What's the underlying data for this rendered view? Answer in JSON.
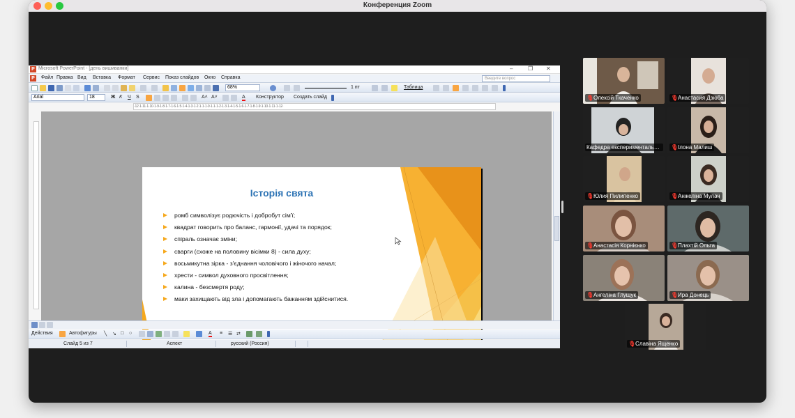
{
  "zoom": {
    "title": "Конференция Zoom"
  },
  "powerpoint": {
    "window_title": "Microsoft PowerPoint - [день вишиванки]",
    "menu": [
      "Файл",
      "Правка",
      "Вид",
      "Вставка",
      "Формат",
      "Сервис",
      "Показ слайдов",
      "Окно",
      "Справка"
    ],
    "ask_placeholder": "Введите вопрос",
    "zoom_level": "68%",
    "line_width": "1 пт",
    "table_label": "Таблица",
    "font_name": "Arial",
    "font_size": "18",
    "designer_label": "Конструктор",
    "new_slide_label": "Создать слайд",
    "draw_label": "Действия",
    "autoshapes_label": "Автофигуры",
    "ruler": "·12·1·11·1·10·1·9·1·8·1·7·1·6·1·5·1·4·1·3·1·2·1·1·1·0·1·1·1·2·1·3·1·4·1·5·1·6·1·7·1·8·1·9·1·10·1·11·1·12·",
    "status": {
      "slide": "Слайд 5 из 7",
      "design": "Аспект",
      "language": "русский (Россия)"
    }
  },
  "slide": {
    "title": "Історія свята",
    "bullets": [
      "ромб символізує родючість і добробут сім'ї;",
      "квадрат говорить про баланс, гармонії, удачі та порядок;",
      "спіраль означає зміни;",
      "сварги (схоже на половину вісімки 8) - сила духу;",
      "восьмикутна зірка - з'єднання чоловічого і жіночого начал;",
      "хрести - символ духовного просвітлення;",
      "калина - безсмертя роду;",
      "маки захищають від зла і допомагають бажанням здійснитися."
    ],
    "accent_color": "#f6a81c",
    "title_color": "#2e74b5"
  },
  "participants": [
    {
      "name": "Олексій Ткаченко",
      "muted": true,
      "active": false
    },
    {
      "name": "Анастасия Дзюба",
      "muted": true,
      "active": false
    },
    {
      "name": "Кафедра експериментальної...",
      "muted": false,
      "active": false
    },
    {
      "name": "Ілона Малиш",
      "muted": true,
      "active": false
    },
    {
      "name": "Юлия Пилипенко",
      "muted": true,
      "active": false
    },
    {
      "name": "Анжеліна Мулач",
      "muted": true,
      "active": false
    },
    {
      "name": "Анастасія Корнієнко",
      "muted": true,
      "active": false
    },
    {
      "name": "Плахтій Ольга",
      "muted": true,
      "active": false
    },
    {
      "name": "Ангеліна Глущук",
      "muted": true,
      "active": false
    },
    {
      "name": "Ира Донець",
      "muted": true,
      "active": true
    },
    {
      "name": "Славіна Ященко",
      "muted": true,
      "active": false
    }
  ],
  "icons": {
    "mic_off": "mic-off-icon",
    "cursor": "mouse-pointer-icon"
  },
  "colors": {
    "zoom_active_speaker": "#32c53a",
    "mic_off": "#ff3b30"
  }
}
